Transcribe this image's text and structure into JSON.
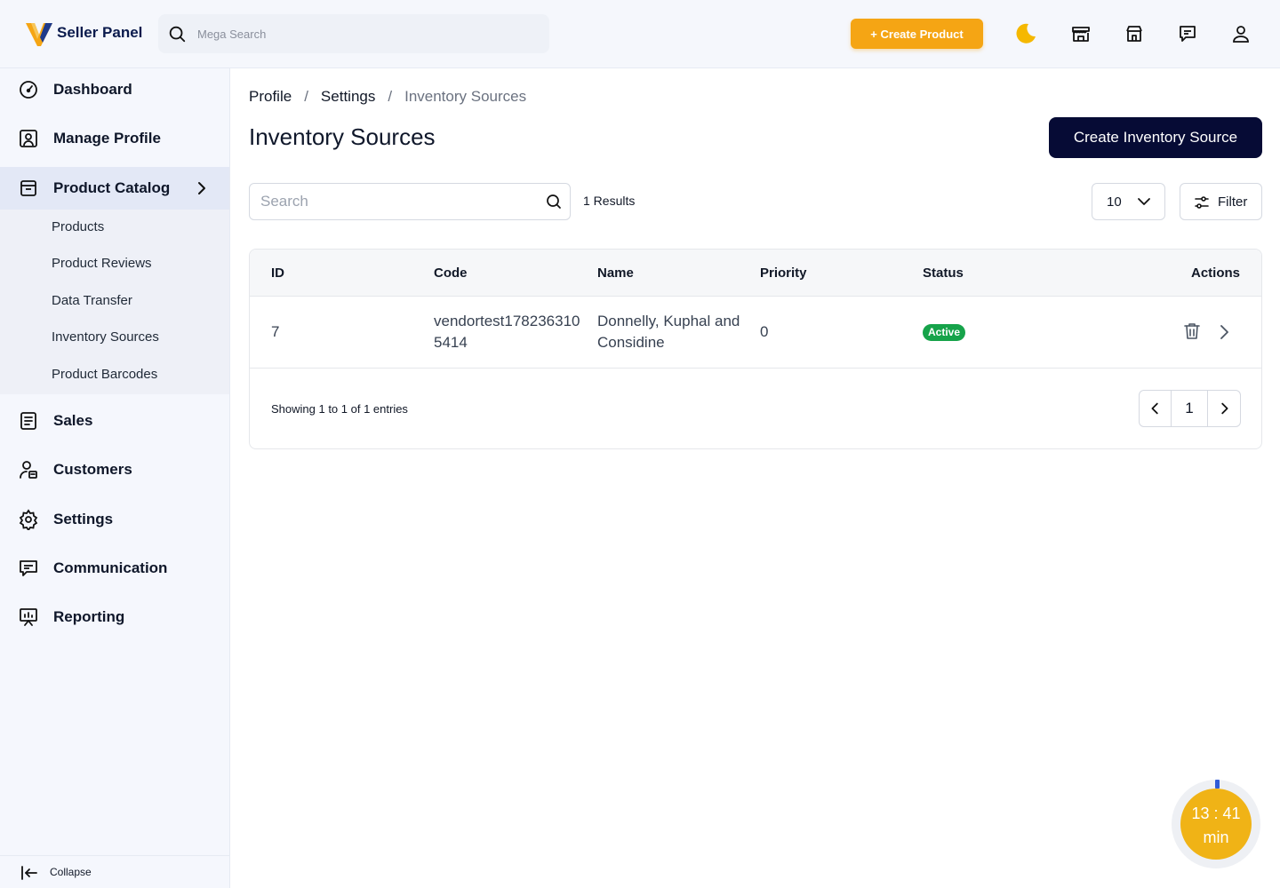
{
  "header": {
    "brand": "Seller Panel",
    "search_placeholder": "Mega Search",
    "create_product_label": "+ Create Product",
    "icons": [
      "moon-icon",
      "store-icon",
      "shop-icon",
      "chat-icon",
      "user-icon"
    ]
  },
  "sidebar": {
    "items": [
      {
        "label": "Dashboard",
        "icon": "dashboard-icon"
      },
      {
        "label": "Manage Profile",
        "icon": "profile-icon"
      },
      {
        "label": "Product Catalog",
        "icon": "catalog-icon",
        "active": true
      },
      {
        "label": "Sales",
        "icon": "sales-icon"
      },
      {
        "label": "Customers",
        "icon": "customers-icon"
      },
      {
        "label": "Settings",
        "icon": "settings-icon"
      },
      {
        "label": "Communication",
        "icon": "communication-icon"
      },
      {
        "label": "Reporting",
        "icon": "reporting-icon"
      }
    ],
    "submenu": [
      "Products",
      "Product Reviews",
      "Data Transfer",
      "Inventory Sources",
      "Product Barcodes"
    ],
    "collapse_label": "Collapse"
  },
  "breadcrumb": [
    "Profile",
    "Settings",
    "Inventory Sources"
  ],
  "page_title": "Inventory Sources",
  "create_button_label": "Create Inventory Source",
  "toolbar": {
    "search_placeholder": "Search",
    "results": "1 Results",
    "per_page": "10",
    "filter_label": "Filter"
  },
  "table": {
    "columns": [
      "ID",
      "Code",
      "Name",
      "Priority",
      "Status",
      "Actions"
    ],
    "rows": [
      {
        "id": "7",
        "code_line1": "vendortest178236310",
        "code_line2": "5414",
        "name_line1": "Donnelly, Kuphal and",
        "name_line2": "Considine",
        "priority": "0",
        "status": "Active"
      }
    ]
  },
  "pagination": {
    "showing": "Showing 1 to 1 of 1 entries",
    "current_page": "1"
  },
  "timer": {
    "time": "13 : 41",
    "unit": "min"
  },
  "colors": {
    "accent": "#f5a514",
    "primary_button": "#060b35",
    "status_active": "#16a34a",
    "timer": "#f0b316"
  }
}
